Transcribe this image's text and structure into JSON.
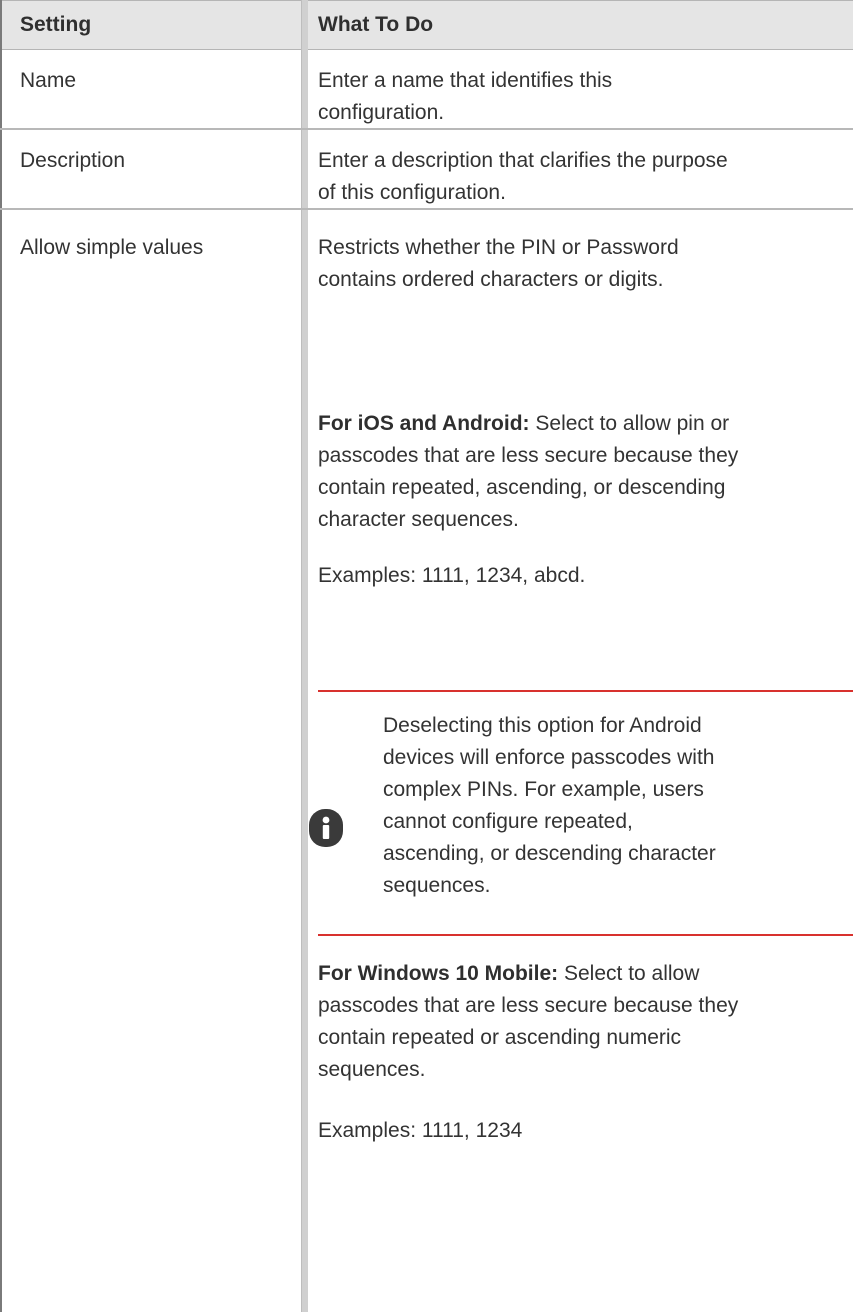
{
  "table": {
    "headers": {
      "setting": "Setting",
      "what_to_do": "What To Do"
    },
    "rows": [
      {
        "setting": "Name",
        "lines": [
          "Enter a name that identifies this",
          "configuration."
        ]
      },
      {
        "setting": "Description",
        "lines": [
          "Enter a description that clarifies the purpose",
          "of this configuration."
        ]
      },
      {
        "setting": "Allow simple values",
        "intro": [
          "Restricts whether the PIN or Password",
          "contains ordered characters or digits."
        ],
        "ios_android": {
          "label": "For iOS and Android:",
          "first_line": " Select to allow  pin or",
          "lines": [
            "passcodes that are less secure because they",
            "contain repeated, ascending, or descending",
            "character sequences."
          ]
        },
        "examples_1": "Examples: 1111, 1234, abcd.",
        "note": {
          "icon": "info-icon",
          "lines": [
            "Deselecting this option for Android",
            "devices will enforce passcodes with",
            "complex PINs. For example, users",
            "cannot configure repeated,",
            "ascending, or descending character",
            "sequences."
          ]
        },
        "windows": {
          "label": "For Windows 10 Mobile:",
          "first_line": " Select to allow",
          "lines": [
            "passcodes that are less secure because they",
            "contain repeated or ascending numeric",
            "sequences."
          ]
        },
        "examples_2": "Examples: 1111, 1234"
      }
    ]
  },
  "colors": {
    "header_bg": "#e5e5e5",
    "note_rule": "#d8312e",
    "text": "#333333"
  }
}
